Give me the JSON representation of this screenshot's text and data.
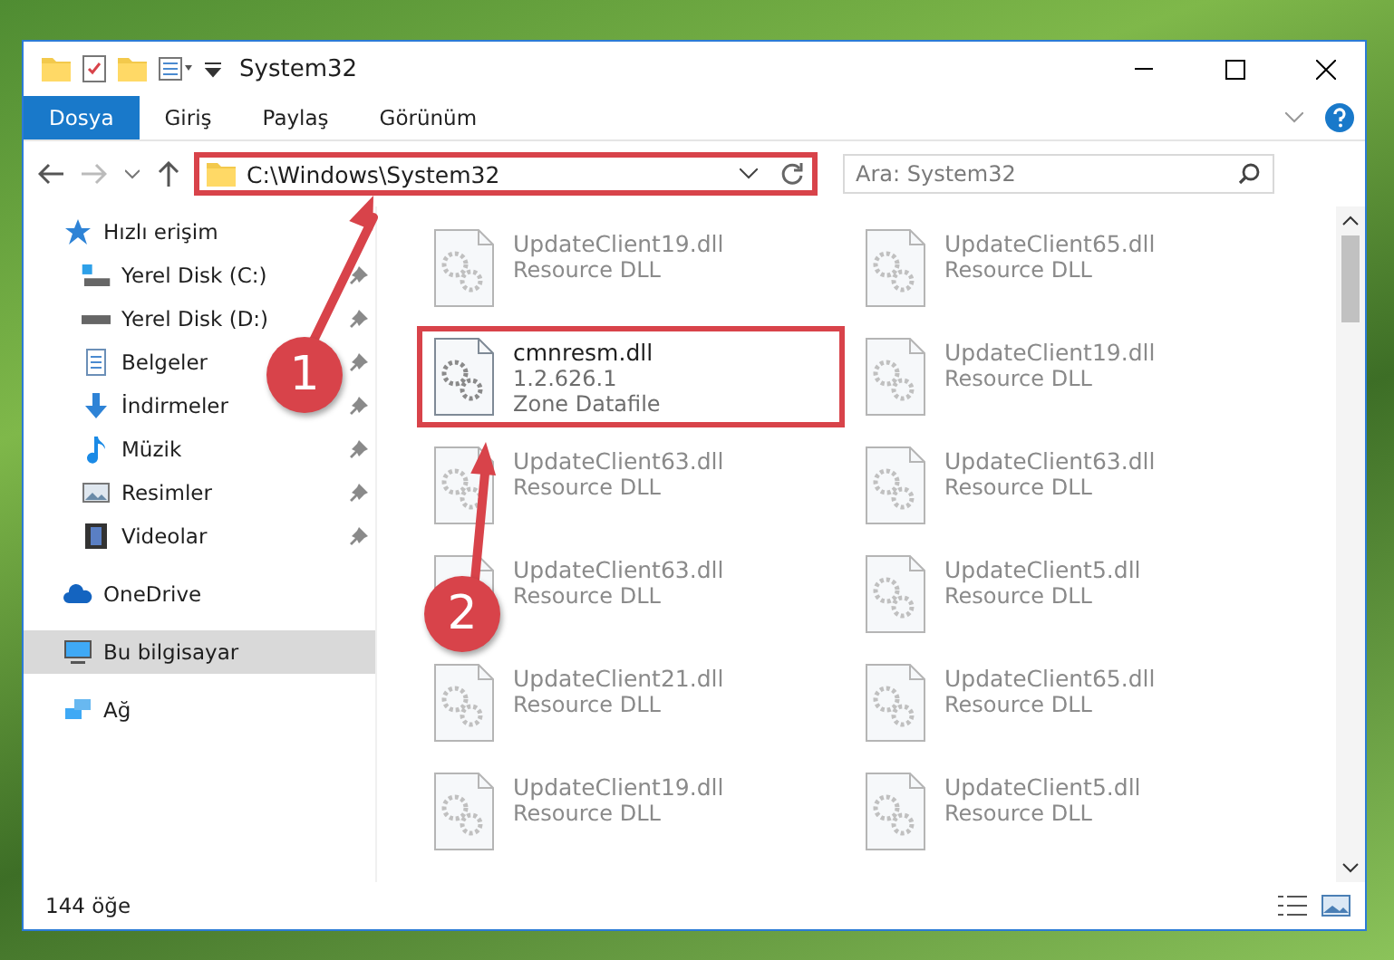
{
  "window": {
    "title": "System32"
  },
  "ribbon_tabs": [
    {
      "label": "Dosya",
      "kind": "file"
    },
    {
      "label": "Giriş",
      "kind": "tab"
    },
    {
      "label": "Paylaş",
      "kind": "tab"
    },
    {
      "label": "Görünüm",
      "kind": "tab"
    }
  ],
  "address": {
    "path": "C:\\Windows\\System32",
    "highlighted": true
  },
  "search": {
    "placeholder": "Ara: System32"
  },
  "sidebar": {
    "items": [
      {
        "label": "Hızlı erişim",
        "kind": "star",
        "selected": false,
        "children": [
          {
            "label": "Yerel Disk (C:)",
            "kind": "system-drive",
            "pinned": true
          },
          {
            "label": "Yerel Disk (D:)",
            "kind": "drive",
            "pinned": true
          },
          {
            "label": "Belgeler",
            "kind": "documents",
            "pinned": true
          },
          {
            "label": "İndirmeler",
            "kind": "downloads",
            "pinned": true
          },
          {
            "label": "Müzik",
            "kind": "music",
            "pinned": true
          },
          {
            "label": "Resimler",
            "kind": "pictures",
            "pinned": true
          },
          {
            "label": "Videolar",
            "kind": "videos",
            "pinned": true
          }
        ]
      },
      {
        "label": "OneDrive",
        "kind": "cloud",
        "selected": false
      },
      {
        "label": "Bu bilgisayar",
        "kind": "computer",
        "selected": true
      },
      {
        "label": "Ağ",
        "kind": "network",
        "selected": false
      }
    ]
  },
  "files": [
    {
      "name": "UpdateClient19.dll",
      "details": [
        "Resource DLL"
      ],
      "blurred": true,
      "highlighted": false
    },
    {
      "name": "UpdateClient65.dll",
      "details": [
        "Resource DLL"
      ],
      "blurred": true,
      "highlighted": false
    },
    {
      "name": "cmnresm.dll",
      "details": [
        "1.2.626.1",
        "Zone Datafile"
      ],
      "blurred": false,
      "highlighted": true
    },
    {
      "name": "UpdateClient19.dll",
      "details": [
        "Resource DLL"
      ],
      "blurred": true,
      "highlighted": false
    },
    {
      "name": "UpdateClient63.dll",
      "details": [
        "Resource DLL"
      ],
      "blurred": true,
      "highlighted": false
    },
    {
      "name": "UpdateClient63.dll",
      "details": [
        "Resource DLL"
      ],
      "blurred": true,
      "highlighted": false
    },
    {
      "name": "UpdateClient63.dll",
      "details": [
        "Resource DLL"
      ],
      "blurred": true,
      "highlighted": false
    },
    {
      "name": "UpdateClient5.dll",
      "details": [
        "Resource DLL"
      ],
      "blurred": true,
      "highlighted": false
    },
    {
      "name": "UpdateClient21.dll",
      "details": [
        "Resource DLL"
      ],
      "blurred": true,
      "highlighted": false
    },
    {
      "name": "UpdateClient65.dll",
      "details": [
        "Resource DLL"
      ],
      "blurred": true,
      "highlighted": false
    },
    {
      "name": "UpdateClient19.dll",
      "details": [
        "Resource DLL"
      ],
      "blurred": true,
      "highlighted": false
    },
    {
      "name": "UpdateClient5.dll",
      "details": [
        "Resource DLL"
      ],
      "blurred": true,
      "highlighted": false
    }
  ],
  "status_bar": {
    "count": "144 öğe"
  },
  "annotations": [
    {
      "label": "1"
    },
    {
      "label": "2"
    }
  ]
}
